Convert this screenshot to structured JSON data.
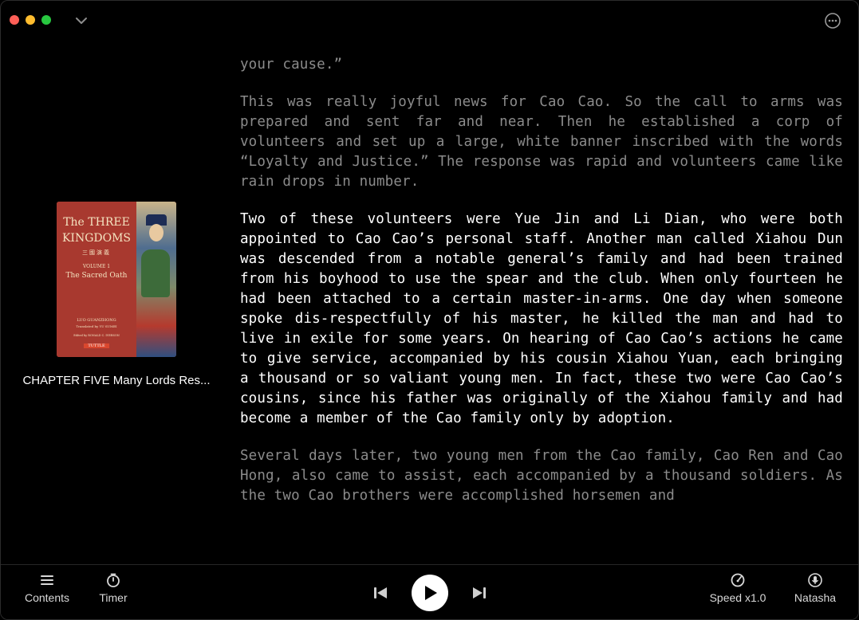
{
  "window": {
    "menu_icon": "chevron-down-icon",
    "more_icon": "ellipsis-circle-icon"
  },
  "sidebar": {
    "cover": {
      "title_line1": "The THREE",
      "title_line2": "KINGDOMS",
      "chinese": "三國演義",
      "volume": "VOLUME 1",
      "subtitle": "The Sacred Oath",
      "author": "LUO GUANZHONG",
      "translator": "Translated by YU SUMEI",
      "editor": "Edited by RONALD C. IVERSON",
      "publisher": "TUTTLE"
    },
    "chapter_title": "CHAPTER FIVE Many Lords Res..."
  },
  "reader": {
    "paragraphs": [
      {
        "style": "dim",
        "text": "your cause.”"
      },
      {
        "style": "dim",
        "text": "This was really joyful news for Cao Cao. So the call to arms was prepared and sent far and near. Then he established a corp of volunteers and set up a large, white banner inscribed with the words “Loyalty and Justice.” The response was rapid and volunteers came like rain drops in number."
      },
      {
        "style": "bright",
        "text": "Two of these volunteers were Yue Jin and Li Dian, who were both appointed to Cao Cao’s personal staff. Another man called Xiahou Dun was descended from a notable general’s family and had been trained from his boyhood to use the spear and the club. When only fourteen he had been attached to a certain master-in-arms. One day when someone spoke dis-respectfully of his master, he killed the man and had to live in exile for some years. On hearing of Cao Cao’s actions he came to give service, accompanied by his cousin Xiahou Yuan, each bringing a thousand or so valiant young men. In fact, these two were Cao Cao’s cousins, since his father was originally of the Xiahou family and had become a member of the Cao family only by adoption."
      },
      {
        "style": "dim",
        "text": "Several days later, two young men from the Cao family, Cao Ren and Cao Hong, also came to assist, each accompanied by a thousand soldiers. As the two Cao brothers were accomplished horsemen and"
      }
    ]
  },
  "toolbar": {
    "contents_label": "Contents",
    "timer_label": "Timer",
    "speed_label": "Speed x1.0",
    "voice_label": "Natasha"
  },
  "colors": {
    "background": "#000000",
    "dim_text": "#8b8b8b",
    "bright_text": "#ffffff"
  }
}
